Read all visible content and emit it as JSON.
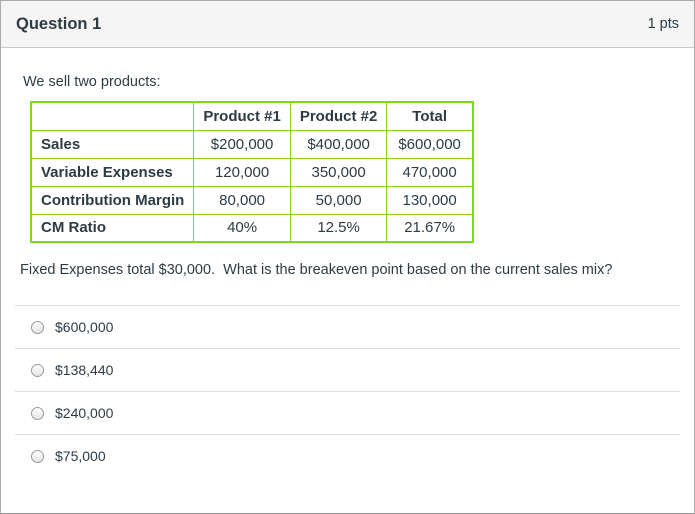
{
  "header": {
    "title": "Question 1",
    "points": "1 pts"
  },
  "body": {
    "intro": "We sell two products:",
    "question": "Fixed Expenses total $30,000.  What is the breakeven point based on the current sales mix?"
  },
  "table": {
    "columns": [
      "",
      "Product #1",
      "Product #2",
      "Total"
    ],
    "rows": [
      {
        "label": "Sales",
        "values": [
          "$200,000",
          "$400,000",
          "$600,000"
        ]
      },
      {
        "label": "Variable Expenses",
        "values": [
          "120,000",
          "350,000",
          "470,000"
        ]
      },
      {
        "label": "Contribution Margin",
        "values": [
          "80,000",
          "50,000",
          "130,000"
        ]
      },
      {
        "label": "CM Ratio",
        "values": [
          "40%",
          "12.5%",
          "21.67%"
        ]
      }
    ]
  },
  "answers": {
    "options": [
      {
        "label": "$600,000"
      },
      {
        "label": "$138,440"
      },
      {
        "label": "$240,000"
      },
      {
        "label": "$75,000"
      }
    ]
  },
  "colors": {
    "table_border": "#7CDB11",
    "header_background": "#f5f5f5",
    "text": "#2D3B45"
  }
}
